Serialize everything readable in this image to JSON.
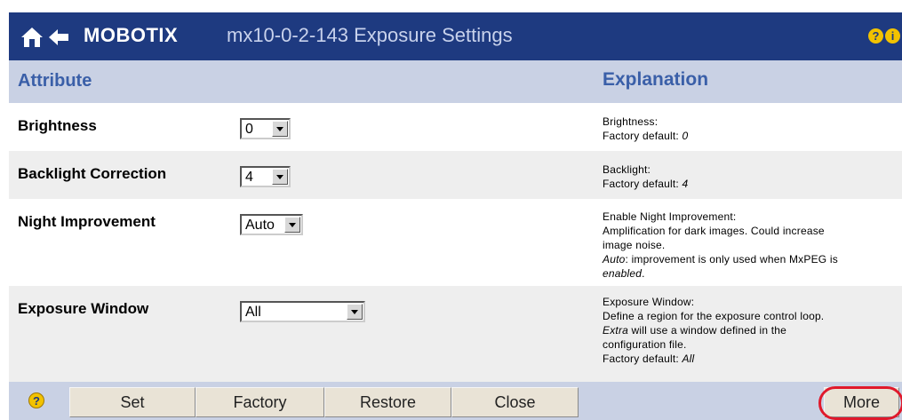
{
  "header": {
    "brand": "MOBOTIX",
    "title": "mx10-0-2-143 Exposure Settings",
    "help_glyph": "?",
    "info_glyph": "i",
    "colors": {
      "bar": "#1e3a80",
      "subheader": "#c9d1e4",
      "accent_text": "#3a5fa8",
      "highlight": "#e0192b"
    }
  },
  "columns": {
    "attribute": "Attribute",
    "explanation": "Explanation"
  },
  "rows": [
    {
      "label": "Brightness",
      "value": "0",
      "desc": [
        "Brightness:",
        "Factory default: "
      ],
      "desc_em": "0"
    },
    {
      "label": "Backlight Correction",
      "value": "4",
      "desc": [
        "Backlight:",
        "Factory default: "
      ],
      "desc_em": "4"
    },
    {
      "label": "Night Improvement",
      "value": "Auto",
      "desc": [
        "Enable Night Improvement:",
        "Amplification for dark images. Could increase",
        "image noise.",
        ": improvement is only used when MxPEG is"
      ],
      "desc_em": [
        "Auto",
        "enabled",
        "."
      ]
    },
    {
      "label": "Exposure Window",
      "value": "All",
      "desc": [
        "Exposure Window:",
        "Define a region for the exposure control loop.",
        " will use a window defined in the",
        "configuration file.",
        "Factory default: "
      ],
      "desc_em": [
        "Extra",
        "All"
      ]
    }
  ],
  "footer": {
    "help_glyph": "?",
    "buttons": {
      "set": "Set",
      "factory": "Factory",
      "restore": "Restore",
      "close": "Close",
      "more": "More"
    }
  }
}
